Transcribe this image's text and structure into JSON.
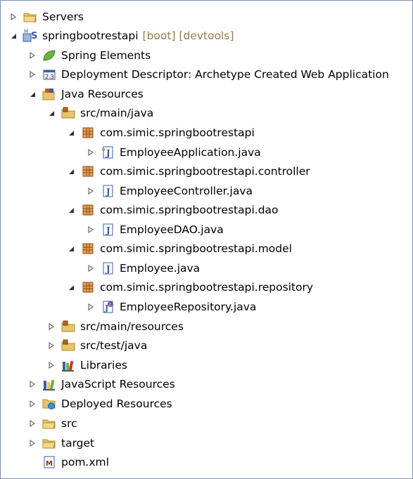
{
  "tree": {
    "servers": {
      "label": "Servers"
    },
    "project": {
      "label": "springbootrestapi",
      "decoration": "[boot] [devtools]"
    },
    "spring_elements": {
      "label": "Spring Elements"
    },
    "deployment_descriptor": {
      "label": "Deployment Descriptor: Archetype Created Web Application"
    },
    "java_resources": {
      "label": "Java Resources"
    },
    "src_main_java": {
      "label": "src/main/java"
    },
    "pkg_root": {
      "label": "com.simic.springbootrestapi"
    },
    "file_employee_application": {
      "label": "EmployeeApplication.java"
    },
    "pkg_controller": {
      "label": "com.simic.springbootrestapi.controller"
    },
    "file_employee_controller": {
      "label": "EmployeeController.java"
    },
    "pkg_dao": {
      "label": "com.simic.springbootrestapi.dao"
    },
    "file_employee_dao": {
      "label": "EmployeeDAO.java"
    },
    "pkg_model": {
      "label": "com.simic.springbootrestapi.model"
    },
    "file_employee": {
      "label": "Employee.java"
    },
    "pkg_repository": {
      "label": "com.simic.springbootrestapi.repository"
    },
    "file_employee_repository": {
      "label": "EmployeeRepository.java"
    },
    "src_main_resources": {
      "label": "src/main/resources"
    },
    "src_test_java": {
      "label": "src/test/java"
    },
    "libraries": {
      "label": "Libraries"
    },
    "javascript_resources": {
      "label": "JavaScript Resources"
    },
    "deployed_resources": {
      "label": "Deployed Resources"
    },
    "src": {
      "label": "src"
    },
    "target": {
      "label": "target"
    },
    "pom": {
      "label": "pom.xml"
    }
  },
  "colors": {
    "folder": "#e8c46a",
    "package": "#b5651d",
    "java_file": "#3b5ea8",
    "spring_leaf": "#6db33f",
    "frame_border": "#7a8fb5",
    "decoration_text": "#9a7a4a"
  }
}
